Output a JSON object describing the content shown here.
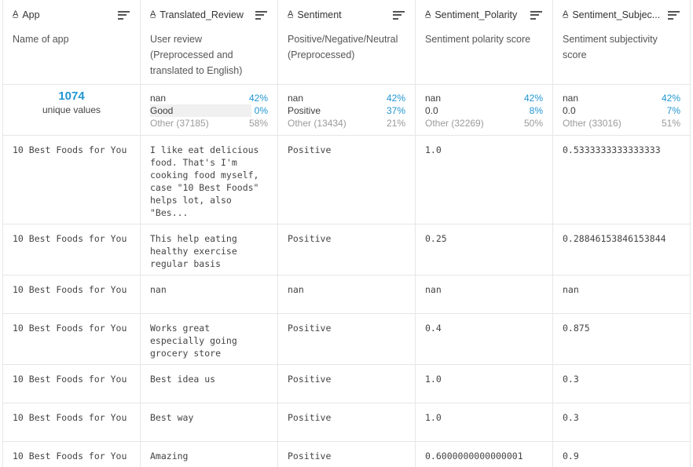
{
  "columns": [
    {
      "name": "App",
      "type_icon": "string-type-icon",
      "description": "Name of app"
    },
    {
      "name": "Translated_Review",
      "type_icon": "string-type-icon",
      "description": "User review (Preprocessed and translated to English)"
    },
    {
      "name": "Sentiment",
      "type_icon": "string-type-icon",
      "description": "Positive/Negative/Neutral (Preprocessed)"
    },
    {
      "name": "Sentiment_Polarity",
      "type_icon": "string-type-icon",
      "description": "Sentiment polarity score"
    },
    {
      "name": "Sentiment_Subjec...",
      "type_icon": "string-type-icon",
      "description": "Sentiment subjectivity score"
    }
  ],
  "summary": {
    "app": {
      "count": "1074",
      "label": "unique values"
    },
    "translated_review": [
      {
        "label": "nan",
        "pct": "42%"
      },
      {
        "label": "Good",
        "pct": "0%"
      },
      {
        "label": "Other (37185)",
        "pct": "58%"
      }
    ],
    "sentiment": [
      {
        "label": "nan",
        "pct": "42%"
      },
      {
        "label": "Positive",
        "pct": "37%"
      },
      {
        "label": "Other (13434)",
        "pct": "21%"
      }
    ],
    "sentiment_polarity": [
      {
        "label": "nan",
        "pct": "42%"
      },
      {
        "label": "0.0",
        "pct": "8%"
      },
      {
        "label": "Other (32269)",
        "pct": "50%"
      }
    ],
    "sentiment_subjectivity": [
      {
        "label": "nan",
        "pct": "42%"
      },
      {
        "label": "0.0",
        "pct": "7%"
      },
      {
        "label": "Other (33016)",
        "pct": "51%"
      }
    ]
  },
  "rows": [
    {
      "app": "10 Best Foods for You",
      "review": "I like eat delicious food. That's I'm cooking food myself, case \"10 Best Foods\" helps lot, also \"Bes...",
      "sentiment": "Positive",
      "polarity": "1.0",
      "subjectivity": "0.5333333333333333"
    },
    {
      "app": "10 Best Foods for You",
      "review": "This help eating healthy exercise regular basis",
      "sentiment": "Positive",
      "polarity": "0.25",
      "subjectivity": "0.28846153846153844"
    },
    {
      "app": "10 Best Foods for You",
      "review": "nan",
      "sentiment": "nan",
      "polarity": "nan",
      "subjectivity": "nan"
    },
    {
      "app": "10 Best Foods for You",
      "review": "Works great especially going grocery store",
      "sentiment": "Positive",
      "polarity": "0.4",
      "subjectivity": "0.875"
    },
    {
      "app": "10 Best Foods for You",
      "review": "Best idea us",
      "sentiment": "Positive",
      "polarity": "1.0",
      "subjectivity": "0.3"
    },
    {
      "app": "10 Best Foods for You",
      "review": "Best way",
      "sentiment": "Positive",
      "polarity": "1.0",
      "subjectivity": "0.3"
    },
    {
      "app": "10 Best Foods for You",
      "review": "Amazing",
      "sentiment": "Positive",
      "polarity": "0.6000000000000001",
      "subjectivity": "0.9"
    }
  ]
}
